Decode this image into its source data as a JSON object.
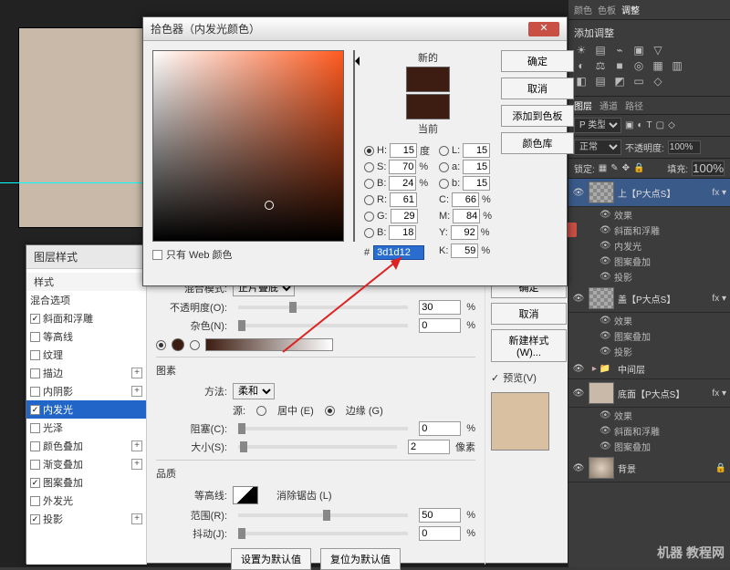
{
  "colorPicker": {
    "title": "拾色器（内发光颜色）",
    "newLabel": "新的",
    "currentLabel": "当前",
    "okBtn": "确定",
    "cancelBtn": "取消",
    "addSwatch": "添加到色板",
    "colorLib": "颜色库",
    "fields": {
      "H": {
        "label": "H:",
        "val": "15",
        "unit": "度"
      },
      "S": {
        "label": "S:",
        "val": "70",
        "unit": "%"
      },
      "B": {
        "label": "B:",
        "val": "24",
        "unit": "%"
      },
      "R": {
        "label": "R:",
        "val": "61"
      },
      "G": {
        "label": "G:",
        "val": "29"
      },
      "Bch": {
        "label": "B:",
        "val": "18"
      },
      "L": {
        "label": "L:",
        "val": "15"
      },
      "a": {
        "label": "a:",
        "val": "15"
      },
      "b": {
        "label": "b:",
        "val": "15"
      },
      "C": {
        "label": "C:",
        "val": "66",
        "unit": "%"
      },
      "M": {
        "label": "M:",
        "val": "84",
        "unit": "%"
      },
      "Y": {
        "label": "Y:",
        "val": "92",
        "unit": "%"
      },
      "K": {
        "label": "K:",
        "val": "59",
        "unit": "%"
      }
    },
    "hex": "3d1d12",
    "webOnly": "只有 Web 颜色"
  },
  "layerStyle": {
    "title": "图层样式",
    "leftHeader": "样式",
    "blendOptions": "混合选项",
    "items": [
      {
        "label": "斜面和浮雕",
        "checked": true
      },
      {
        "label": "等高线",
        "checked": false
      },
      {
        "label": "纹理",
        "checked": false
      },
      {
        "label": "描边",
        "checked": false
      },
      {
        "label": "内阴影",
        "checked": false
      },
      {
        "label": "内发光",
        "checked": true,
        "selected": true
      },
      {
        "label": "光泽",
        "checked": false
      },
      {
        "label": "颜色叠加",
        "checked": false
      },
      {
        "label": "渐变叠加",
        "checked": false
      },
      {
        "label": "图案叠加",
        "checked": true
      },
      {
        "label": "外发光",
        "checked": false
      },
      {
        "label": "投影",
        "checked": true
      }
    ],
    "main": {
      "blendModeLabel": "混合模式:",
      "blendMode": "正片叠底",
      "opacityLabel": "不透明度(O):",
      "opacity": "30",
      "noiseLabel": "杂色(N):",
      "noise": "0",
      "elementsTitle": "图素",
      "techniqueLabel": "方法:",
      "technique": "柔和",
      "sourceLabel": "源:",
      "sourceCenter": "居中 (E)",
      "sourceEdge": "边缘 (G)",
      "chokeLabel": "阻塞(C):",
      "choke": "0",
      "sizeLabel": "大小(S):",
      "size": "2",
      "sizeUnit": "像素",
      "qualityTitle": "品质",
      "contourLabel": "等高线:",
      "antiAlias": "消除锯齿 (L)",
      "rangeLabel": "范围(R):",
      "range": "50",
      "jitterLabel": "抖动(J):",
      "jitter": "0",
      "makeDefault": "设置为默认值",
      "resetDefault": "复位为默认值"
    },
    "right": {
      "ok": "确定",
      "cancel": "取消",
      "newStyle": "新建样式(W)...",
      "preview": "预览(V)"
    }
  },
  "panels": {
    "topTabs": [
      "颜色",
      "色板",
      "调整"
    ],
    "adjustTitle": "添加调整",
    "layersTabs": [
      "图层",
      "通道",
      "路径"
    ],
    "kind": "P 类型",
    "blend": "正常",
    "opacityLbl": "不透明度:",
    "opacity": "100%",
    "lock": "锁定:",
    "fillLbl": "填充:",
    "fill": "100%",
    "layers": [
      {
        "name": "上【P大点S】",
        "fx": true,
        "selected": true,
        "effects": [
          "斜面和浮雕",
          "内发光",
          "图案叠加",
          "投影"
        ],
        "fxLabel": "效果"
      },
      {
        "name": "盖【P大点S】",
        "fx": true,
        "selected": false,
        "effects": [
          "图案叠加",
          "投影"
        ],
        "fxLabel": "效果"
      },
      {
        "name": "中间层",
        "folder": true
      },
      {
        "name": "底面【P大点S】",
        "fx": true,
        "beige": true,
        "effects": [
          "斜面和浮雕",
          "图案叠加"
        ],
        "fxLabel": "效果"
      },
      {
        "name": "背景",
        "lock": true,
        "grad": true
      }
    ]
  },
  "watermark": "机器 教程网"
}
